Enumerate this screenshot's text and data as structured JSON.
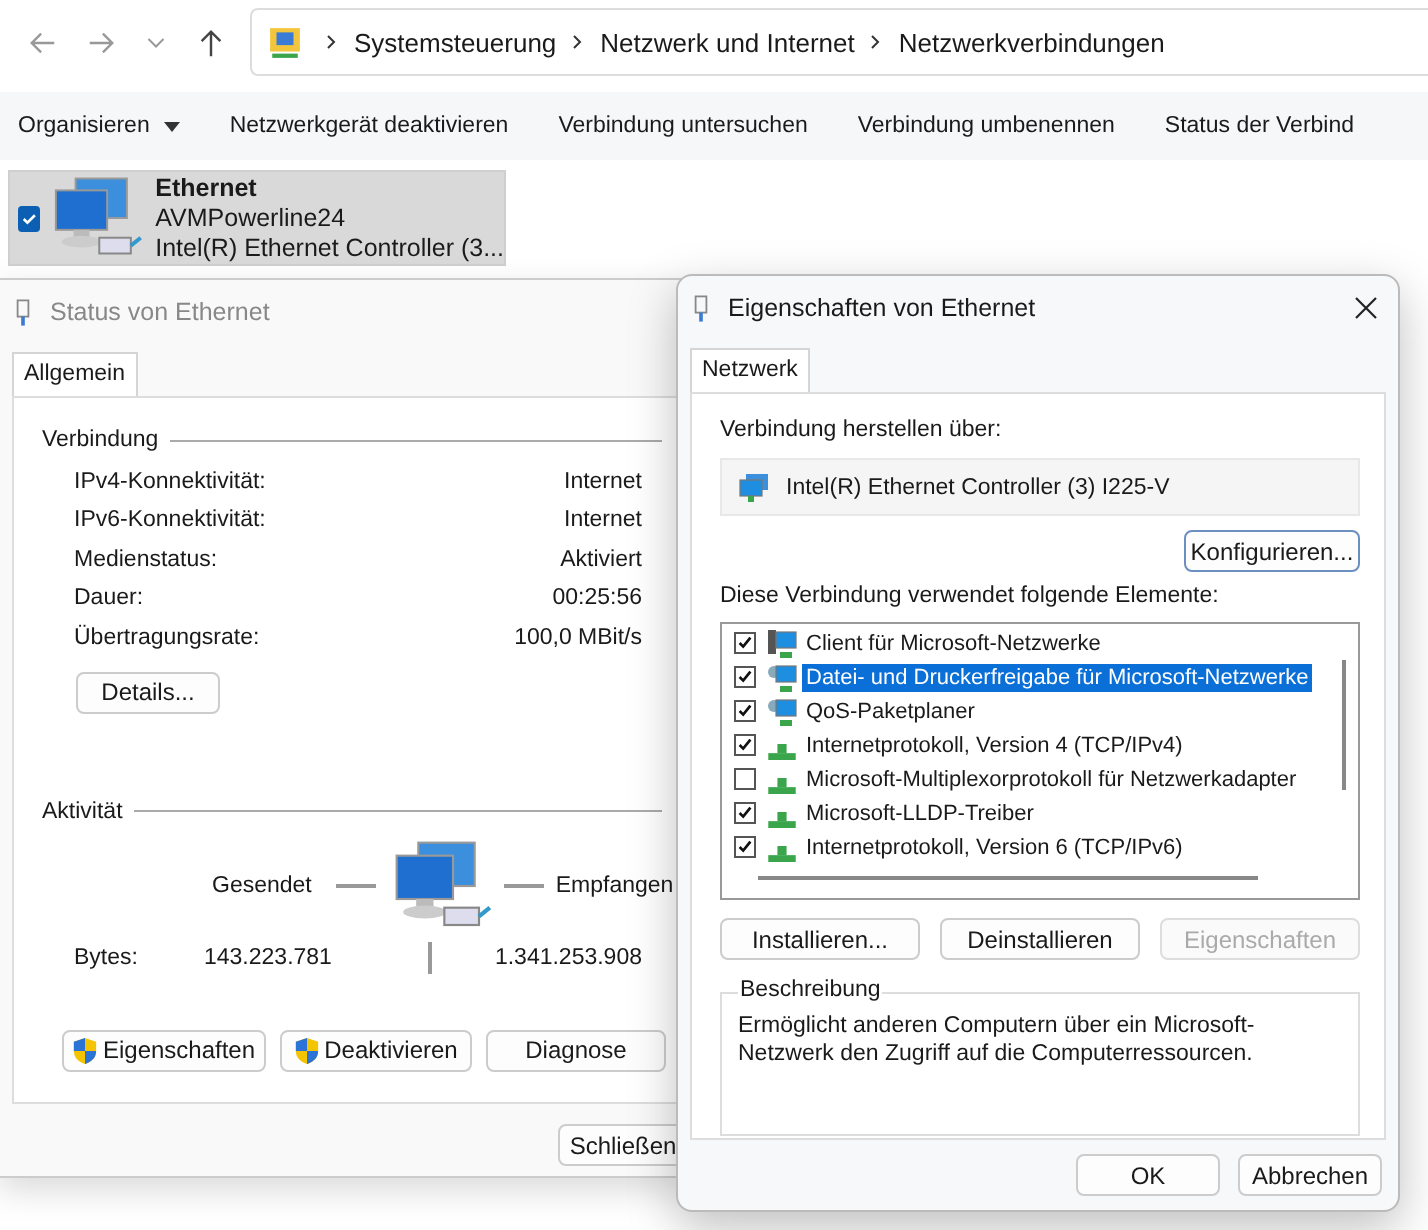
{
  "explorer": {
    "breadcrumb": [
      "Systemsteuerung",
      "Netzwerk und Internet",
      "Netzwerkverbindungen"
    ],
    "toolbar": [
      {
        "label": "Organisieren",
        "dropdown": true
      },
      {
        "label": "Netzwerkgerät deaktivieren",
        "dropdown": false
      },
      {
        "label": "Verbindung untersuchen",
        "dropdown": false
      },
      {
        "label": "Verbindung umbenennen",
        "dropdown": false
      },
      {
        "label": "Status der Verbind",
        "dropdown": false
      }
    ],
    "adapter": {
      "name": "Ethernet",
      "subtitle": "AVMPowerline24",
      "device": "Intel(R) Ethernet Controller (3...",
      "checked": true,
      "selected": true
    }
  },
  "status_window": {
    "title": "Status von Ethernet",
    "tabs": [
      {
        "label": "Allgemein",
        "selected": true
      }
    ],
    "connection": {
      "heading": "Verbindung",
      "rows": [
        {
          "label": "IPv4-Konnektivität:",
          "value": "Internet"
        },
        {
          "label": "IPv6-Konnektivität:",
          "value": "Internet"
        },
        {
          "label": "Medienstatus:",
          "value": "Aktiviert"
        },
        {
          "label": "Dauer:",
          "value": "00:25:56"
        },
        {
          "label": "Übertragungsrate:",
          "value": "100,0 MBit/s"
        }
      ],
      "details_button": "Details..."
    },
    "activity": {
      "heading": "Aktivität",
      "sent_label": "Gesendet",
      "received_label": "Empfangen",
      "bytes_label": "Bytes:",
      "sent": "143.223.781",
      "received": "1.341.253.908"
    },
    "buttons": [
      {
        "label": "Eigenschaften",
        "shield": true
      },
      {
        "label": "Deaktivieren",
        "shield": true
      },
      {
        "label": "Diagnose",
        "shield": false
      }
    ],
    "close_button": "Schließen"
  },
  "properties_window": {
    "title": "Eigenschaften von Ethernet",
    "tabs": [
      {
        "label": "Netzwerk",
        "selected": true
      }
    ],
    "connect_via_label": "Verbindung herstellen über:",
    "adapter": "Intel(R) Ethernet Controller (3) I225-V",
    "configure_button": "Konfigurieren...",
    "items_label": "Diese Verbindung verwendet folgende Elemente:",
    "items": [
      {
        "label": "Client für Microsoft-Netzwerke",
        "checked": true,
        "selected": false,
        "kind": "client"
      },
      {
        "label": "Datei- und Druckerfreigabe für Microsoft-Netzwerke",
        "checked": true,
        "selected": true,
        "kind": "service"
      },
      {
        "label": "QoS-Paketplaner",
        "checked": true,
        "selected": false,
        "kind": "service"
      },
      {
        "label": "Internetprotokoll, Version 4 (TCP/IPv4)",
        "checked": true,
        "selected": false,
        "kind": "protocol"
      },
      {
        "label": "Microsoft-Multiplexorprotokoll für Netzwerkadapter",
        "checked": false,
        "selected": false,
        "kind": "protocol"
      },
      {
        "label": "Microsoft-LLDP-Treiber",
        "checked": true,
        "selected": false,
        "kind": "protocol"
      },
      {
        "label": "Internetprotokoll, Version 6 (TCP/IPv6)",
        "checked": true,
        "selected": false,
        "kind": "protocol"
      }
    ],
    "buttons": [
      {
        "label": "Installieren...",
        "disabled": false
      },
      {
        "label": "Deinstallieren",
        "disabled": false
      },
      {
        "label": "Eigenschaften",
        "disabled": true
      }
    ],
    "description": {
      "heading": "Beschreibung",
      "text": "Ermöglicht anderen Computern über ein Microsoft-Netzwerk den Zugriff auf die Computerressourcen."
    },
    "ok_button": "OK",
    "cancel_button": "Abbrechen"
  }
}
